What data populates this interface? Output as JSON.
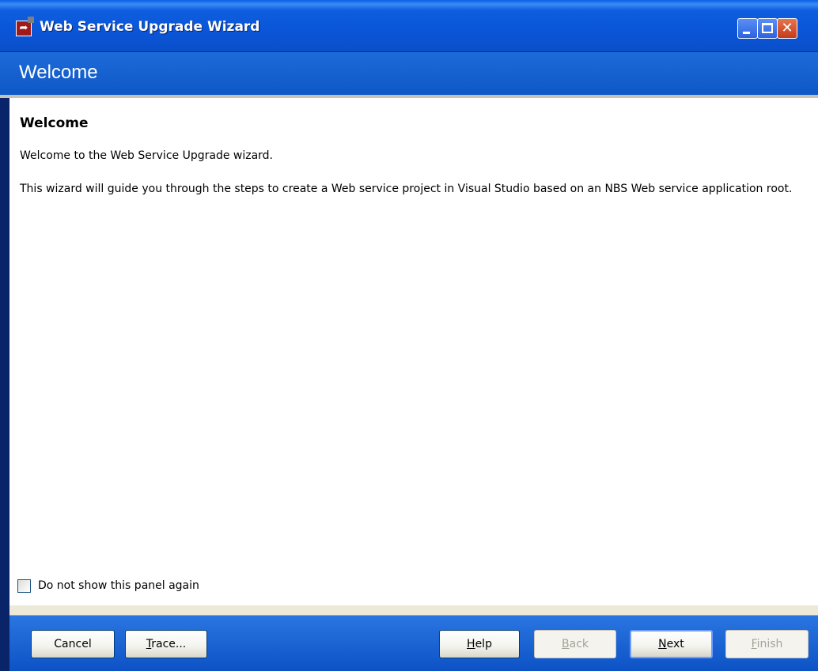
{
  "window": {
    "title": "Web Service Upgrade Wizard",
    "icon": "wizard-app-icon",
    "controls": {
      "minimize_icon": "minimize-icon",
      "maximize_icon": "maximize-icon",
      "close_icon": "close-icon",
      "close_glyph": "✕"
    }
  },
  "header": {
    "title": "Welcome"
  },
  "content": {
    "heading": "Welcome",
    "paragraphs": [
      "Welcome to the Web Service Upgrade wizard.",
      "This wizard will guide you through the steps to create a Web service project in Visual Studio based on an NBS Web service application root."
    ],
    "checkbox": {
      "label": "Do not show this panel again",
      "checked": false
    }
  },
  "buttons": {
    "cancel": {
      "label": "Cancel",
      "enabled": true
    },
    "trace": {
      "label_mnemonic": "T",
      "label_rest": "race...",
      "enabled": true
    },
    "help": {
      "label_mnemonic": "H",
      "label_rest": "elp",
      "enabled": true
    },
    "back": {
      "label_mnemonic": "B",
      "label_rest": "ack",
      "enabled": false
    },
    "next": {
      "label_mnemonic": "N",
      "label_rest": "ext",
      "enabled": true
    },
    "finish": {
      "label_mnemonic": "F",
      "label_rest": "inish",
      "enabled": false
    }
  },
  "colors": {
    "titlebar": "#0a55d8",
    "header_band": "#1c6bd8",
    "button_bar": "#1a63d4",
    "close_button": "#c53b1a"
  }
}
